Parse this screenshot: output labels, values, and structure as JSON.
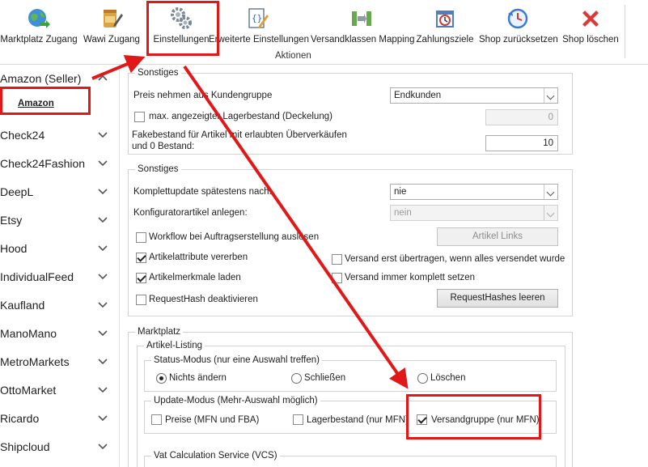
{
  "toolbar": {
    "buttons": [
      {
        "label": "Marktplatz Zugang",
        "icon": "globe-arrow-icon"
      },
      {
        "label": "Wawi Zugang",
        "icon": "jar-pencil-icon"
      },
      {
        "label": "Einstellungen",
        "icon": "gears-icon"
      },
      {
        "label": "Erweiterte Einstellungen",
        "icon": "code-edit-icon"
      },
      {
        "label": "Versandklassen Mapping",
        "icon": "mapping-arrows-icon"
      },
      {
        "label": "Zahlungsziele",
        "icon": "calendar-clock-icon"
      },
      {
        "label": "Shop zurücksetzen",
        "icon": "reset-clock-icon"
      },
      {
        "label": "Shop löschen",
        "icon": "red-x-icon"
      }
    ],
    "group_label": "Aktionen"
  },
  "sidebar": {
    "items": [
      {
        "label": "Amazon (Seller)",
        "expanded": true
      },
      {
        "label": "Check24"
      },
      {
        "label": "Check24Fashion"
      },
      {
        "label": "DeepL"
      },
      {
        "label": "Etsy"
      },
      {
        "label": "Hood"
      },
      {
        "label": "IndividualFeed"
      },
      {
        "label": "Kaufland"
      },
      {
        "label": "ManoMano"
      },
      {
        "label": "MetroMarkets"
      },
      {
        "label": "OttoMarket"
      },
      {
        "label": "Ricardo"
      },
      {
        "label": "Shipcloud"
      }
    ],
    "sub_item": "Amazon"
  },
  "sonstiges1": {
    "title": "Sonstiges",
    "preis_label": "Preis nehmen aus Kundengruppe",
    "preis_value": "Endkunden",
    "max_label": "max. angezeigter Lagerbestand (Deckelung)",
    "max_checked": false,
    "max_value": "0",
    "fake_label_1": "Fakebestand für Artikel mit erlaubten Überverkäufen",
    "fake_label_2": "und 0 Bestand:",
    "fake_value": "10"
  },
  "sonstiges2": {
    "title": "Sonstiges",
    "komplett_label": "Komplettupdate spätestens nach:",
    "komplett_value": "nie",
    "konfig_label": "Konfiguratorartikel anlegen:",
    "konfig_value": "nein",
    "workflow_label": "Workflow bei Auftragserstellung auslösen",
    "workflow_checked": false,
    "artikel_links_button": "Artikel Links",
    "attribute_label": "Artikelattribute vererben",
    "attribute_checked": true,
    "versand_erst_label": "Versand erst übertragen, wenn alles versendet wurde",
    "versand_erst_checked": false,
    "merkmale_label": "Artikelmerkmale laden",
    "merkmale_checked": true,
    "versand_immer_label": "Versand immer komplett setzen",
    "versand_immer_checked": false,
    "requesthash_label": "RequestHash deaktivieren",
    "requesthash_checked": false,
    "requesthashes_button": "RequestHashes leeren"
  },
  "marktplatz": {
    "title": "Marktplatz",
    "listing_title": "Artikel-Listing",
    "status_title": "Status-Modus (nur eine Auswahl treffen)",
    "status_options": [
      {
        "label": "Nichts ändern",
        "selected": true
      },
      {
        "label": "Schließen",
        "selected": false
      },
      {
        "label": "Löschen",
        "selected": false
      }
    ],
    "update_title": "Update-Modus (Mehr-Auswahl möglich)",
    "update_options": [
      {
        "label": "Preise (MFN und FBA)",
        "checked": false
      },
      {
        "label": "Lagerbestand (nur MFN)",
        "checked": false
      },
      {
        "label": "Versandgruppe (nur MFN)",
        "checked": true
      }
    ],
    "vcs_title": "Vat Calculation Service (VCS)"
  },
  "colors": {
    "annotation_red": "#e01818",
    "border": "#d2d2d2"
  }
}
